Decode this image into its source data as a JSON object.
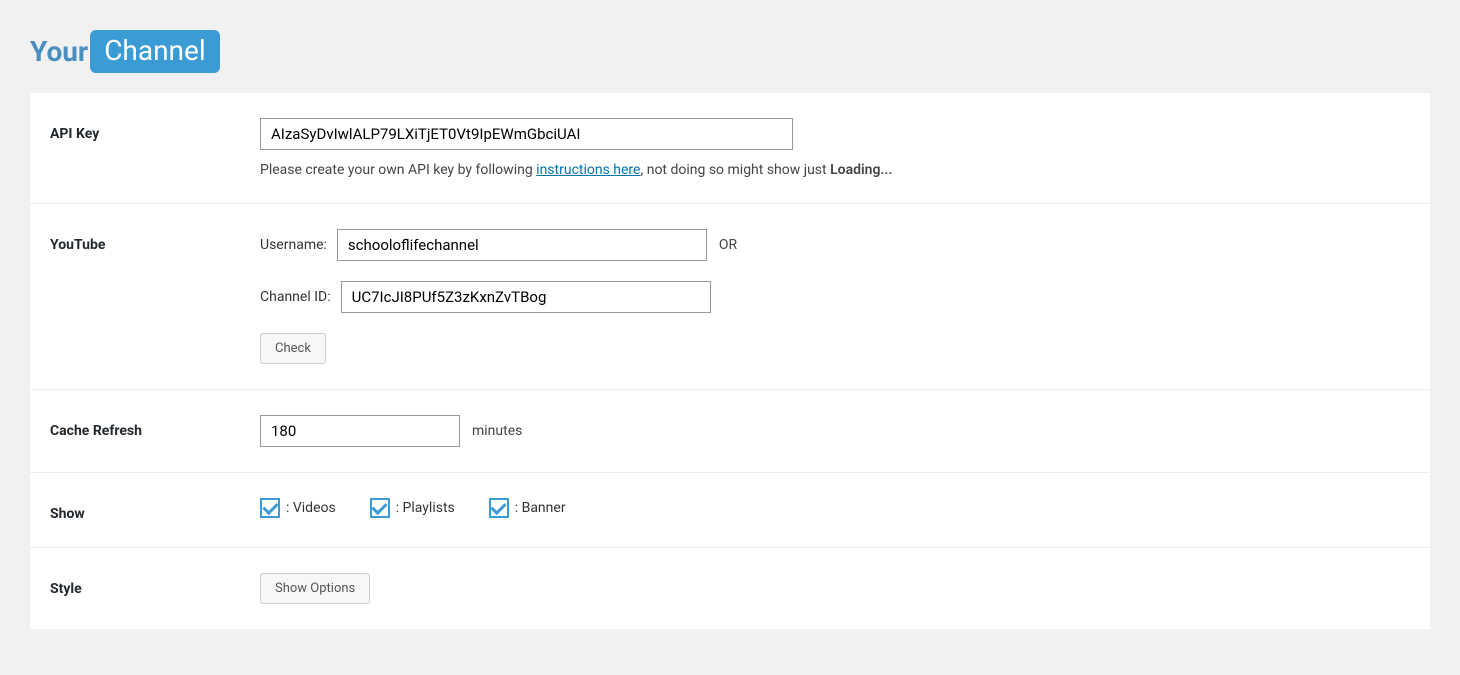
{
  "logo": {
    "your": "Your",
    "channel": "Channel"
  },
  "apiKey": {
    "label": "API Key",
    "value": "AIzaSyDvIwlALP79LXiTjET0Vt9IpEWmGbciUAI",
    "help_pre": "Please create your own API key by following ",
    "help_link": "instructions here",
    "help_mid": ", not doing so might show just ",
    "help_strong": "Loading..."
  },
  "youtube": {
    "label": "YouTube",
    "username_label": "Username:",
    "username_value": "schooloflifechannel",
    "or": "OR",
    "channel_id_label": "Channel ID:",
    "channel_id_value": "UC7IcJI8PUf5Z3zKxnZvTBog",
    "check_button": "Check"
  },
  "cache": {
    "label": "Cache Refresh",
    "value": "180",
    "unit": "minutes"
  },
  "show": {
    "label": "Show",
    "videos": ": Videos",
    "playlists": ": Playlists",
    "banner": ": Banner"
  },
  "style": {
    "label": "Style",
    "button": "Show Options"
  }
}
